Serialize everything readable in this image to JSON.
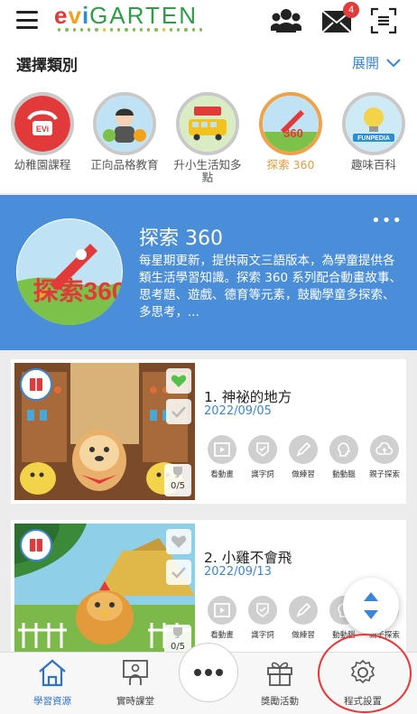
{
  "header": {
    "logo_text_e": "e",
    "logo_text_v": "v",
    "logo_text_i": "i",
    "logo_text_garten": "GARTEN",
    "mail_badge": "4",
    "icons": [
      "menu-icon",
      "group-icon",
      "mail-icon",
      "scan-icon"
    ]
  },
  "categories": {
    "title": "選擇類別",
    "expand_label": "展開",
    "items": [
      {
        "label": "幼稚園課程",
        "icon": "evi-logo-icon"
      },
      {
        "label": "正向品格教育",
        "icon": "character-icon"
      },
      {
        "label": "升小生活知多點",
        "icon": "school-bus-icon"
      },
      {
        "label": "探索 360",
        "icon": "rocket-360-icon"
      },
      {
        "label": "趣味百科",
        "icon": "funpedia-icon"
      }
    ],
    "active_index": 3
  },
  "banner": {
    "title": "探索 360",
    "description": "每星期更新，提供兩文三語版本，為學童提供各類生活學習知識。探索 360 系列配合動畫故事、思考題、遊戲、德育等元素，鼓勵學童多探索、多思考，...",
    "logo_text": "探索360"
  },
  "lessons": [
    {
      "title": "1. 神祕的地方",
      "date": "2022/09/05",
      "progress": "0/5",
      "liked": true,
      "activities": [
        "看動畫",
        "識字詞",
        "做練習",
        "動動腦",
        "親子探索"
      ]
    },
    {
      "title": "2. 小雞不會飛",
      "date": "2022/09/13",
      "progress": "0/5",
      "liked": false,
      "activities": [
        "看動畫",
        "識字詞",
        "做練習",
        "動動腦",
        "親子探索"
      ]
    }
  ],
  "bottom_nav": [
    {
      "label": "學習資源",
      "icon": "home-icon",
      "active": true
    },
    {
      "label": "實時課堂",
      "icon": "live-class-icon",
      "active": false
    },
    {
      "label": "獎勵活動",
      "icon": "gift-icon",
      "active": false
    },
    {
      "label": "程式設置",
      "icon": "settings-icon",
      "active": false
    }
  ],
  "colors": {
    "accent_blue": "#4a8dd8",
    "active_orange": "#e79a3c",
    "badge_red": "#e33b3b",
    "annotation_red": "#e33333"
  }
}
